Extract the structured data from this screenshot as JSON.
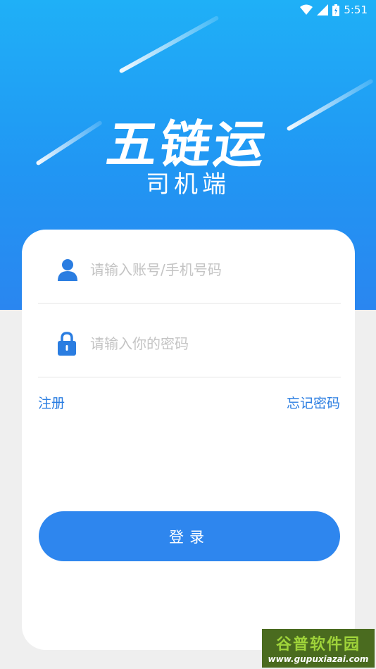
{
  "status_bar": {
    "time": "5:51",
    "icons": [
      "wifi-icon",
      "signal-icon",
      "battery-icon"
    ]
  },
  "brand": {
    "title": "五链运",
    "subtitle": "司机端"
  },
  "form": {
    "account_placeholder": "请输入账号/手机号码",
    "password_placeholder": "请输入你的密码",
    "register_label": "注册",
    "forgot_label": "忘记密码",
    "login_label": "登录"
  },
  "watermark": {
    "text": "谷普软件园",
    "url": "www.gupuxiazai.com"
  },
  "colors": {
    "hero_top": "#1fb0f7",
    "hero_bottom": "#2a86f0",
    "accent": "#2e86ee",
    "link": "#2a7de1"
  }
}
